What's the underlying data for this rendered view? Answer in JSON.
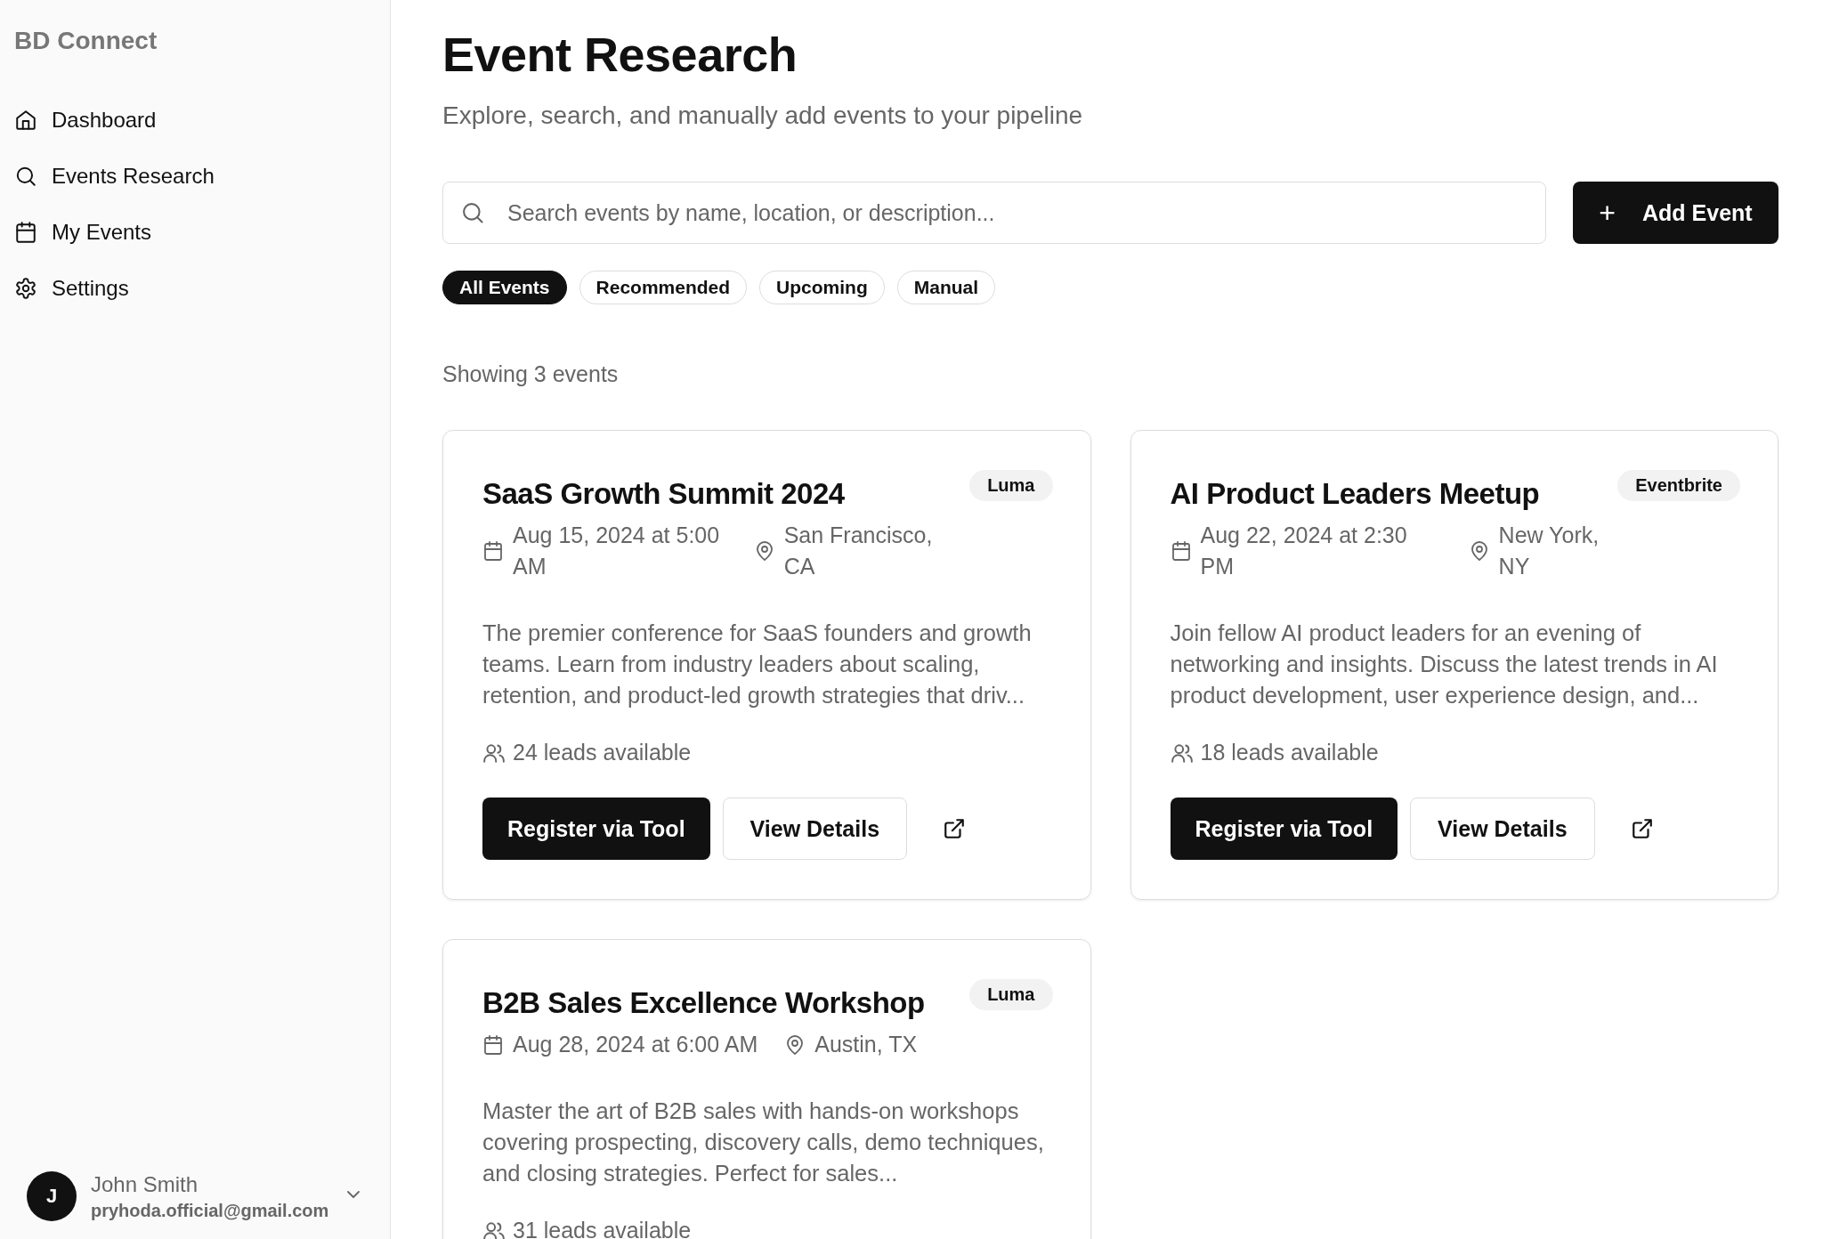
{
  "sidebar": {
    "brand": "BD Connect",
    "items": [
      {
        "label": "Dashboard"
      },
      {
        "label": "Events Research"
      },
      {
        "label": "My Events"
      },
      {
        "label": "Settings"
      }
    ],
    "user": {
      "initial": "J",
      "name": "John Smith",
      "email": "pryhoda.official@gmail.com"
    }
  },
  "header": {
    "title": "Event Research",
    "subtitle": "Explore, search, and manually add events to your pipeline"
  },
  "search": {
    "placeholder": "Search events by name, location, or description..."
  },
  "add_button": {
    "icon": "+",
    "label": "Add Event"
  },
  "filters": [
    {
      "label": "All Events",
      "selected": true
    },
    {
      "label": "Recommended",
      "selected": false
    },
    {
      "label": "Upcoming",
      "selected": false
    },
    {
      "label": "Manual",
      "selected": false
    }
  ],
  "count": "Showing 3 events",
  "events": [
    {
      "title": "SaaS Growth Summit 2024",
      "source": "Luma",
      "date": "Aug 15, 2024 at 5:00 AM",
      "location": "San Francisco, CA",
      "description": "The premier conference for SaaS founders and growth teams. Learn from industry leaders about scaling, retention, and product-led growth strategies that driv...",
      "leads": "24 leads available",
      "primary": "Register via Tool",
      "secondary": "View Details"
    },
    {
      "title": "AI Product Leaders Meetup",
      "source": "Eventbrite",
      "date": "Aug 22, 2024 at 2:30 PM",
      "location": "New York, NY",
      "description": "Join fellow AI product leaders for an evening of networking and insights. Discuss the latest trends in AI product development, user experience design, and...",
      "leads": "18 leads available",
      "primary": "Register via Tool",
      "secondary": "View Details"
    },
    {
      "title": "B2B Sales Excellence Workshop",
      "source": "Luma",
      "date": "Aug 28, 2024 at 6:00 AM",
      "location": "Austin, TX",
      "description": "Master the art of B2B sales with hands-on workshops covering prospecting, discovery calls, demo techniques, and closing strategies. Perfect for sales...",
      "leads": "31 leads available"
    }
  ]
}
